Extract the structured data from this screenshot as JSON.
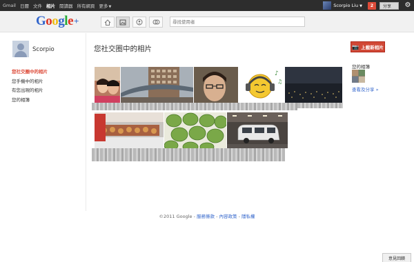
{
  "topbar": {
    "nav": [
      "Gmail",
      "日曆",
      "文件",
      "相片",
      "閱讀器",
      "所有網頁",
      "更多"
    ],
    "user_name": "Scorpio Liu",
    "notification_count": "2",
    "share_label": "分享"
  },
  "header": {
    "logo_text": "Google",
    "logo_plus": "+",
    "search_placeholder": "尋找使用者"
  },
  "profile": {
    "name": "Scorpio"
  },
  "sidebar": {
    "items": [
      {
        "label": "您社交圈中的相片",
        "active": true
      },
      {
        "label": "您手機中的相片",
        "active": false
      },
      {
        "label": "有您出現的相片",
        "active": false
      },
      {
        "label": "您的相簿",
        "active": false
      }
    ]
  },
  "main": {
    "title": "您社交圈中的相片",
    "upload_label": "上載新相片"
  },
  "right": {
    "albums_label": "您的相簿",
    "view_share_link": "查看及分享 »"
  },
  "footer": {
    "copyright": "©2011 Google - ",
    "links": [
      "服務條款",
      "內容政策",
      "隱私權"
    ]
  },
  "feedback_label": "意見回饋",
  "photos": [
    {
      "name": "photo-selfie-couple"
    },
    {
      "name": "photo-building-bridge"
    },
    {
      "name": "photo-man-glasses"
    },
    {
      "name": "photo-emoji-headphones"
    },
    {
      "name": "photo-night-city"
    },
    {
      "name": "photo-food-market"
    },
    {
      "name": "photo-green-dumplings"
    },
    {
      "name": "photo-parking-van"
    }
  ]
}
